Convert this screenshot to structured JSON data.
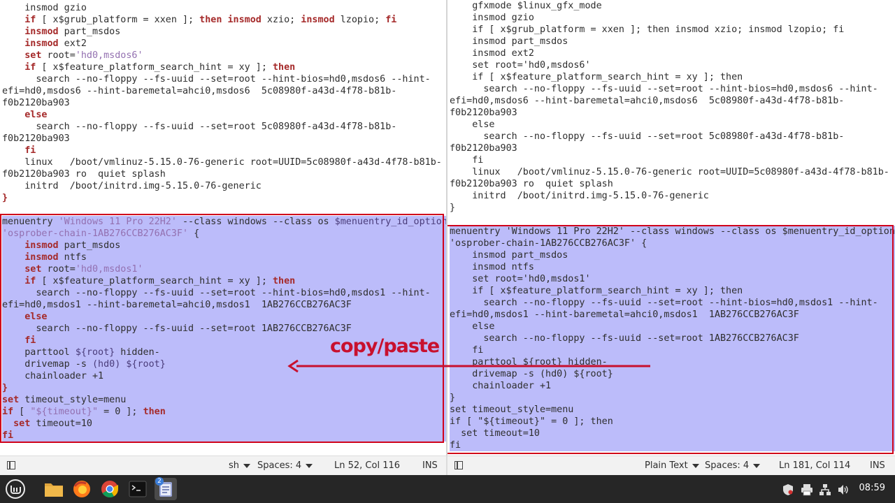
{
  "left_editor": {
    "lines": [
      {
        "segs": [
          {
            "t": "    insmod gzio",
            "c": "blk"
          }
        ]
      },
      {
        "segs": [
          {
            "t": "    if",
            "c": "kw"
          },
          {
            "t": " [ x$grub_platform = xxen ]; ",
            "c": "blk"
          },
          {
            "t": "then",
            "c": "kw"
          },
          {
            "t": " ",
            "c": "blk"
          },
          {
            "t": "insmod",
            "c": "kw"
          },
          {
            "t": " xzio; ",
            "c": "blk"
          },
          {
            "t": "insmod",
            "c": "kw"
          },
          {
            "t": " lzopio; ",
            "c": "blk"
          },
          {
            "t": "fi",
            "c": "kw"
          }
        ]
      },
      {
        "segs": [
          {
            "t": "    insmod",
            "c": "kw"
          },
          {
            "t": " part_msdos",
            "c": "blk"
          }
        ]
      },
      {
        "segs": [
          {
            "t": "    insmod",
            "c": "kw"
          },
          {
            "t": " ext2",
            "c": "blk"
          }
        ]
      },
      {
        "segs": [
          {
            "t": "    set",
            "c": "kw"
          },
          {
            "t": " root=",
            "c": "blk"
          },
          {
            "t": "'hd0,msdos6'",
            "c": "str"
          }
        ]
      },
      {
        "segs": [
          {
            "t": "    if",
            "c": "kw"
          },
          {
            "t": " [ x$feature_platform_search_hint = xy ]; ",
            "c": "blk"
          },
          {
            "t": "then",
            "c": "kw"
          }
        ]
      },
      {
        "segs": [
          {
            "t": "      search --no-floppy --fs-uuid --set=root --hint-bios=hd0,msdos6 --hint-",
            "c": "blk"
          }
        ]
      },
      {
        "segs": [
          {
            "t": "efi=hd0,msdos6 --hint-baremetal=ahci0,msdos6  5c08980f-a43d-4f78-b81b-",
            "c": "blk"
          }
        ]
      },
      {
        "segs": [
          {
            "t": "f0b2120ba903",
            "c": "blk"
          }
        ]
      },
      {
        "segs": [
          {
            "t": "    else",
            "c": "kw"
          }
        ]
      },
      {
        "segs": [
          {
            "t": "      search --no-floppy --fs-uuid --set=root 5c08980f-a43d-4f78-b81b-",
            "c": "blk"
          }
        ]
      },
      {
        "segs": [
          {
            "t": "f0b2120ba903",
            "c": "blk"
          }
        ]
      },
      {
        "segs": [
          {
            "t": "    fi",
            "c": "kw"
          }
        ]
      },
      {
        "segs": [
          {
            "t": "    linux   /boot/vmlinuz-5.15.0-76-generic root=UUID=5c08980f-a43d-4f78-b81b-",
            "c": "blk"
          }
        ]
      },
      {
        "segs": [
          {
            "t": "f0b2120ba903 ro  quiet splash",
            "c": "blk"
          }
        ]
      },
      {
        "segs": [
          {
            "t": "    initrd  /boot/initrd.img-5.15.0-76-generic",
            "c": "blk"
          }
        ]
      },
      {
        "segs": [
          {
            "t": "}",
            "c": "kw"
          }
        ]
      },
      {
        "segs": [
          {
            "t": " ",
            "c": "blk"
          }
        ]
      },
      {
        "sel": true,
        "segs": [
          {
            "t": "menuentry ",
            "c": "blk"
          },
          {
            "t": "'Windows 11 Pro 22H2'",
            "c": "str"
          },
          {
            "t": " --class windows --class os ",
            "c": "blk"
          },
          {
            "t": "$menuentry_id_option",
            "c": "var"
          }
        ]
      },
      {
        "sel": true,
        "segs": [
          {
            "t": "'osprober-chain-1AB276CCB276AC3F'",
            "c": "str"
          },
          {
            "t": " {",
            "c": "blk"
          }
        ]
      },
      {
        "sel": true,
        "segs": [
          {
            "t": "    insmod",
            "c": "kw"
          },
          {
            "t": " part_msdos",
            "c": "blk"
          }
        ]
      },
      {
        "sel": true,
        "segs": [
          {
            "t": "    insmod",
            "c": "kw"
          },
          {
            "t": " ntfs",
            "c": "blk"
          }
        ]
      },
      {
        "sel": true,
        "segs": [
          {
            "t": "    set",
            "c": "kw"
          },
          {
            "t": " root=",
            "c": "blk"
          },
          {
            "t": "'hd0,msdos1'",
            "c": "str"
          }
        ]
      },
      {
        "sel": true,
        "segs": [
          {
            "t": "    if",
            "c": "kw"
          },
          {
            "t": " [ x$feature_platform_search_hint = xy ]; ",
            "c": "blk"
          },
          {
            "t": "then",
            "c": "kw"
          }
        ]
      },
      {
        "sel": true,
        "segs": [
          {
            "t": "      search --no-floppy --fs-uuid --set=root --hint-bios=hd0,msdos1 --hint-",
            "c": "blk"
          }
        ]
      },
      {
        "sel": true,
        "segs": [
          {
            "t": "efi=hd0,msdos1 --hint-baremetal=ahci0,msdos1  1AB276CCB276AC3F",
            "c": "blk"
          }
        ]
      },
      {
        "sel": true,
        "segs": [
          {
            "t": "    else",
            "c": "kw"
          }
        ]
      },
      {
        "sel": true,
        "segs": [
          {
            "t": "      search --no-floppy --fs-uuid --set=root 1AB276CCB276AC3F",
            "c": "blk"
          }
        ]
      },
      {
        "sel": true,
        "segs": [
          {
            "t": "    fi",
            "c": "kw"
          }
        ]
      },
      {
        "sel": true,
        "segs": [
          {
            "t": "    parttool ",
            "c": "blk"
          },
          {
            "t": "${root}",
            "c": "var"
          },
          {
            "t": " hidden-",
            "c": "blk"
          }
        ]
      },
      {
        "sel": true,
        "segs": [
          {
            "t": "    drivemap -s ",
            "c": "blk"
          },
          {
            "t": "(hd0)",
            "c": "var"
          },
          {
            "t": " ",
            "c": "blk"
          },
          {
            "t": "${root}",
            "c": "var"
          }
        ]
      },
      {
        "sel": true,
        "segs": [
          {
            "t": "    chainloader +1",
            "c": "blk"
          }
        ]
      },
      {
        "sel": true,
        "segs": [
          {
            "t": "}",
            "c": "kw"
          }
        ]
      },
      {
        "sel": true,
        "segs": [
          {
            "t": "set",
            "c": "kw"
          },
          {
            "t": " timeout_style=menu",
            "c": "blk"
          }
        ]
      },
      {
        "sel": true,
        "segs": [
          {
            "t": "if",
            "c": "kw"
          },
          {
            "t": " [ ",
            "c": "blk"
          },
          {
            "t": "\"${timeout}\"",
            "c": "str"
          },
          {
            "t": " = 0 ]; ",
            "c": "blk"
          },
          {
            "t": "then",
            "c": "kw"
          }
        ]
      },
      {
        "sel": true,
        "segs": [
          {
            "t": "  set",
            "c": "kw"
          },
          {
            "t": " timeout=10",
            "c": "blk"
          }
        ]
      },
      {
        "sel": true,
        "segs": [
          {
            "t": "fi",
            "c": "kw"
          }
        ]
      }
    ]
  },
  "right_editor": {
    "lines": [
      {
        "segs": [
          {
            "t": "    gfxmode $linux_gfx_mode",
            "c": "blk"
          }
        ]
      },
      {
        "segs": [
          {
            "t": "    insmod gzio",
            "c": "blk"
          }
        ]
      },
      {
        "segs": [
          {
            "t": "    if [ x$grub_platform = xxen ]; then insmod xzio; insmod lzopio; fi",
            "c": "blk"
          }
        ]
      },
      {
        "segs": [
          {
            "t": "    insmod part_msdos",
            "c": "blk"
          }
        ]
      },
      {
        "segs": [
          {
            "t": "    insmod ext2",
            "c": "blk"
          }
        ]
      },
      {
        "segs": [
          {
            "t": "    set root='hd0,msdos6'",
            "c": "blk"
          }
        ]
      },
      {
        "segs": [
          {
            "t": "    if [ x$feature_platform_search_hint = xy ]; then",
            "c": "blk"
          }
        ]
      },
      {
        "segs": [
          {
            "t": "      search --no-floppy --fs-uuid --set=root --hint-bios=hd0,msdos6 --hint-",
            "c": "blk"
          }
        ]
      },
      {
        "segs": [
          {
            "t": "efi=hd0,msdos6 --hint-baremetal=ahci0,msdos6  5c08980f-a43d-4f78-b81b-",
            "c": "blk"
          }
        ]
      },
      {
        "segs": [
          {
            "t": "f0b2120ba903",
            "c": "blk"
          }
        ]
      },
      {
        "segs": [
          {
            "t": "    else",
            "c": "blk"
          }
        ]
      },
      {
        "segs": [
          {
            "t": "      search --no-floppy --fs-uuid --set=root 5c08980f-a43d-4f78-b81b-",
            "c": "blk"
          }
        ]
      },
      {
        "segs": [
          {
            "t": "f0b2120ba903",
            "c": "blk"
          }
        ]
      },
      {
        "segs": [
          {
            "t": "    fi",
            "c": "blk"
          }
        ]
      },
      {
        "segs": [
          {
            "t": "    linux   /boot/vmlinuz-5.15.0-76-generic root=UUID=5c08980f-a43d-4f78-b81b-",
            "c": "blk"
          }
        ]
      },
      {
        "segs": [
          {
            "t": "f0b2120ba903 ro  quiet splash",
            "c": "blk"
          }
        ]
      },
      {
        "segs": [
          {
            "t": "    initrd  /boot/initrd.img-5.15.0-76-generic",
            "c": "blk"
          }
        ]
      },
      {
        "segs": [
          {
            "t": "}",
            "c": "blk"
          }
        ]
      },
      {
        "segs": [
          {
            "t": " ",
            "c": "blk"
          }
        ]
      },
      {
        "sel": true,
        "segs": [
          {
            "t": "menuentry 'Windows 11 Pro 22H2' --class windows --class os $menuentry_id_option",
            "c": "blk"
          }
        ]
      },
      {
        "sel": true,
        "segs": [
          {
            "t": "'osprober-chain-1AB276CCB276AC3F' {",
            "c": "blk"
          }
        ]
      },
      {
        "sel": true,
        "segs": [
          {
            "t": "    insmod part_msdos",
            "c": "blk"
          }
        ]
      },
      {
        "sel": true,
        "segs": [
          {
            "t": "    insmod ntfs",
            "c": "blk"
          }
        ]
      },
      {
        "sel": true,
        "segs": [
          {
            "t": "    set root='hd0,msdos1'",
            "c": "blk"
          }
        ]
      },
      {
        "sel": true,
        "segs": [
          {
            "t": "    if [ x$feature_platform_search_hint = xy ]; then",
            "c": "blk"
          }
        ]
      },
      {
        "sel": true,
        "segs": [
          {
            "t": "      search --no-floppy --fs-uuid --set=root --hint-bios=hd0,msdos1 --hint-",
            "c": "blk"
          }
        ]
      },
      {
        "sel": true,
        "segs": [
          {
            "t": "efi=hd0,msdos1 --hint-baremetal=ahci0,msdos1  1AB276CCB276AC3F",
            "c": "blk"
          }
        ]
      },
      {
        "sel": true,
        "segs": [
          {
            "t": "    else",
            "c": "blk"
          }
        ]
      },
      {
        "sel": true,
        "segs": [
          {
            "t": "      search --no-floppy --fs-uuid --set=root 1AB276CCB276AC3F",
            "c": "blk"
          }
        ]
      },
      {
        "sel": true,
        "segs": [
          {
            "t": "    fi",
            "c": "blk"
          }
        ]
      },
      {
        "sel": true,
        "segs": [
          {
            "t": "    parttool ${root} hidden-",
            "c": "blk"
          }
        ]
      },
      {
        "sel": true,
        "segs": [
          {
            "t": "    drivemap -s (hd0) ${root}",
            "c": "blk"
          }
        ]
      },
      {
        "sel": true,
        "segs": [
          {
            "t": "    chainloader +1",
            "c": "blk"
          }
        ]
      },
      {
        "sel": true,
        "segs": [
          {
            "t": "}",
            "c": "blk"
          }
        ]
      },
      {
        "sel": true,
        "segs": [
          {
            "t": "set timeout_style=menu",
            "c": "blk"
          }
        ]
      },
      {
        "sel": true,
        "segs": [
          {
            "t": "if [ \"${timeout}\" = 0 ]; then",
            "c": "blk"
          }
        ]
      },
      {
        "sel": true,
        "segs": [
          {
            "t": "  set timeout=10",
            "c": "blk"
          }
        ]
      },
      {
        "sel": true,
        "segs": [
          {
            "t": "fi",
            "c": "blk"
          }
        ]
      }
    ]
  },
  "left_status": {
    "language": "sh",
    "spaces": "Spaces: 4",
    "position": "Ln 52, Col 116",
    "mode": "INS"
  },
  "right_status": {
    "language": "Plain Text",
    "spaces": "Spaces: 4",
    "position": "Ln 181, Col 114",
    "mode": "INS"
  },
  "annotation": {
    "text": "copy/paste",
    "color": "#c8102e"
  },
  "colors": {
    "selection": "#bcbcfa",
    "highlight_border": "#d0021b",
    "taskbar": "#262626"
  },
  "taskbar": {
    "apps": [
      "mint-menu-icon",
      "files-folder-icon",
      "firefox-icon",
      "chrome-icon",
      "terminal-icon",
      "text-editor-icon"
    ],
    "editor_badge": "2",
    "tray": [
      "shield-icon",
      "printer-icon",
      "network-icon",
      "volume-icon"
    ],
    "clock": "08:59"
  }
}
